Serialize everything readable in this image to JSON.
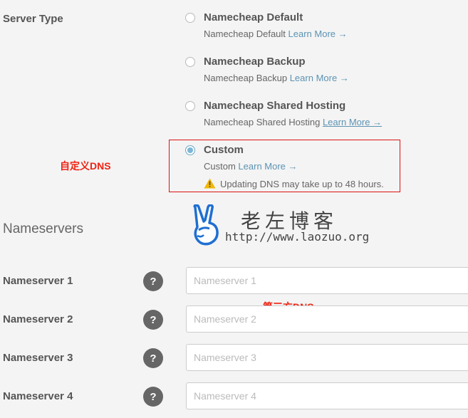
{
  "server_type": {
    "label": "Server Type",
    "options": [
      {
        "title": "Namecheap Default",
        "desc": "Namecheap Default",
        "learn": "Learn More",
        "arrow": "→",
        "checked": false
      },
      {
        "title": "Namecheap Backup",
        "desc": "Namecheap Backup",
        "learn": "Learn More",
        "arrow": "→",
        "checked": false
      },
      {
        "title": "Namecheap Shared Hosting",
        "desc": "Namecheap Shared Hosting",
        "learn": "Learn More",
        "arrow": "→",
        "checked": false
      },
      {
        "title": "Custom",
        "desc": "Custom",
        "learn": "Learn More",
        "arrow": "→",
        "checked": true
      }
    ],
    "warning": "Updating DNS may take up to 48 hours."
  },
  "annotations": {
    "custom_dns": "自定义DNS",
    "third_party_dns": "第三方DNS"
  },
  "watermark": {
    "name": "老左博客",
    "url": "http://www.laozuo.org"
  },
  "nameservers": {
    "heading": "Nameservers",
    "help_glyph": "?",
    "rows": [
      {
        "label": "Nameserver 1",
        "placeholder": "Nameserver 1"
      },
      {
        "label": "Nameserver 2",
        "placeholder": "Nameserver 2"
      },
      {
        "label": "Nameserver 3",
        "placeholder": "Nameserver 3"
      },
      {
        "label": "Nameserver 4",
        "placeholder": "Nameserver 4"
      }
    ]
  },
  "colors": {
    "accent": "#5c93b3",
    "annotation_red": "#e21",
    "warning_yellow": "#f2b705"
  }
}
